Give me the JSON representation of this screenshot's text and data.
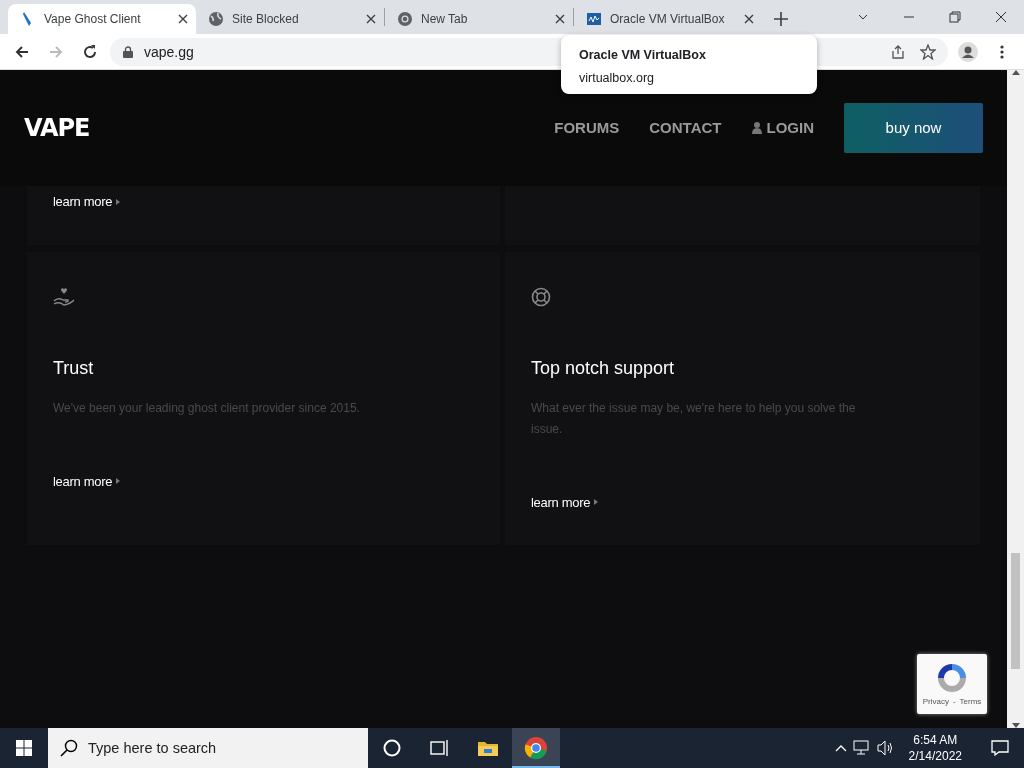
{
  "browser": {
    "tabs": [
      {
        "title": "Vape Ghost Client",
        "selected": true
      },
      {
        "title": "Site Blocked",
        "selected": false
      },
      {
        "title": "New Tab",
        "selected": false
      },
      {
        "title": "Oracle VM VirtualBox",
        "selected": false
      }
    ],
    "address": "vape.gg",
    "tooltip": {
      "title": "Oracle VM VirtualBox",
      "url": "virtualbox.org"
    }
  },
  "site": {
    "logo": "VAPE",
    "nav": [
      {
        "label": "FORUMS"
      },
      {
        "label": "CONTACT"
      },
      {
        "label": "LOGIN"
      }
    ],
    "cta": "buy now",
    "top_cards": [
      {
        "link": "learn more"
      }
    ],
    "cards": [
      {
        "title": "Trust",
        "text": "We've been your leading ghost client provider since 2015.",
        "link": "learn more"
      },
      {
        "title": "Top notch support",
        "text": "What ever the issue may be, we're here to help you solve the issue.",
        "link": "learn more"
      }
    ],
    "recaptcha": {
      "privacy": "Privacy",
      "separator": "-",
      "terms": "Terms"
    }
  },
  "taskbar": {
    "search_placeholder": "Type here to search",
    "apps": [
      {
        "selected": false
      },
      {
        "selected": true
      }
    ],
    "time": "6:54 AM",
    "date": "2/14/2022"
  }
}
